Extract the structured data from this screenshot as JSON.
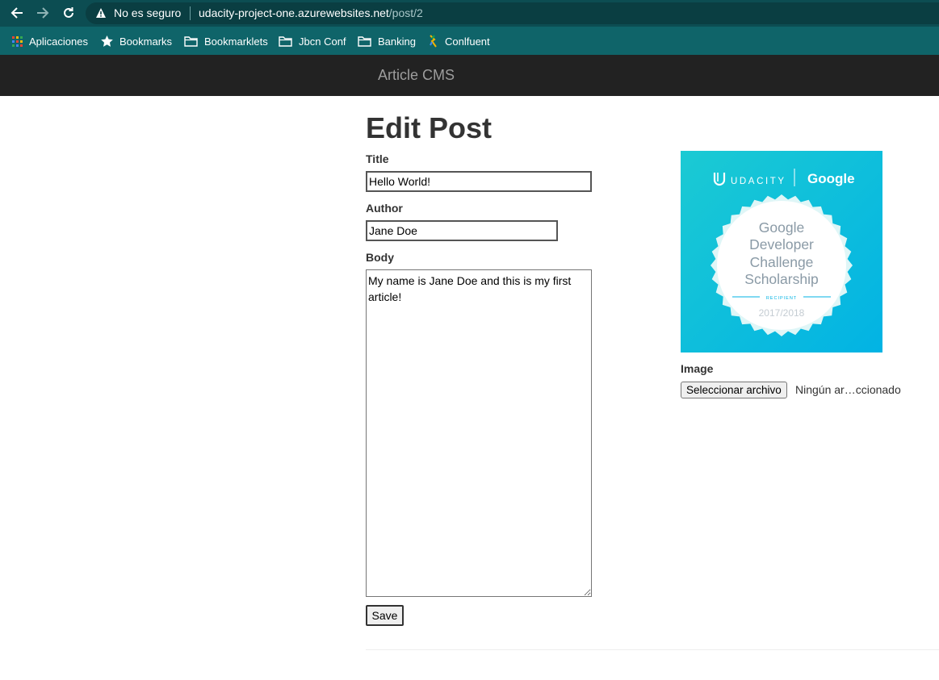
{
  "browser": {
    "not_secure_label": "No es seguro",
    "url_host": "udacity-project-one.azurewebsites.net",
    "url_path": "/post/2",
    "bookmarks": [
      {
        "label": "Aplicaciones",
        "icon": "apps-grid-icon"
      },
      {
        "label": "Bookmarks",
        "icon": "star-icon"
      },
      {
        "label": "Bookmarklets",
        "icon": "folder-icon"
      },
      {
        "label": "Jbcn Conf",
        "icon": "folder-icon"
      },
      {
        "label": "Banking",
        "icon": "folder-icon"
      },
      {
        "label": "Conlfuent",
        "icon": "confluent-logo-icon"
      }
    ]
  },
  "navbar": {
    "brand": "Article CMS"
  },
  "form": {
    "heading": "Edit Post",
    "title_label": "Title",
    "title_value": "Hello World!",
    "author_label": "Author",
    "author_value": "Jane Doe",
    "body_label": "Body",
    "body_value": "My name is Jane Doe and this is my first article!",
    "save_label": "Save",
    "image_label": "Image",
    "file_button_label": "Seleccionar archivo",
    "file_status": "Ningún ar…ccionado"
  },
  "image": {
    "brand_left": "UDACITY",
    "brand_right": "Google",
    "badge_lines": [
      "Google",
      "Developer",
      "Challenge",
      "Scholarship"
    ],
    "badge_tag": "RECIPIENT",
    "badge_year": "2017/2018"
  },
  "colors": {
    "address_bar": "#0c4d52",
    "bookmarks_bar": "#0f6469",
    "navbar": "#222222",
    "image_gradient_start": "#1bcad3",
    "image_gradient_end": "#02b3e4"
  }
}
